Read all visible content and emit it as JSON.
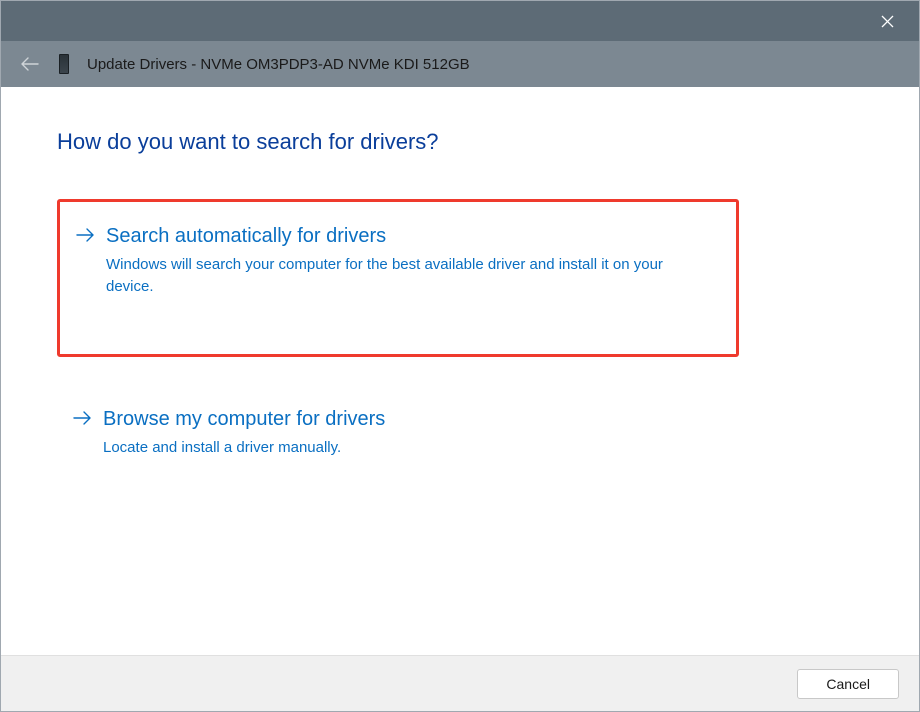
{
  "titlebar": {
    "title": "Update Drivers - NVMe OM3PDP3-AD NVMe KDI 512GB"
  },
  "main": {
    "heading": "How do you want to search for drivers?",
    "options": [
      {
        "title": "Search automatically for drivers",
        "description": "Windows will search your computer for the best available driver and install it on your device."
      },
      {
        "title": "Browse my computer for drivers",
        "description": "Locate and install a driver manually."
      }
    ]
  },
  "footer": {
    "cancel": "Cancel"
  },
  "colors": {
    "titlebar_top": "#5d6b76",
    "titlebar_sub": "#7c8892",
    "heading": "#0a3e9a",
    "link": "#0a6fc2",
    "highlight_border": "#ef3a2d"
  }
}
